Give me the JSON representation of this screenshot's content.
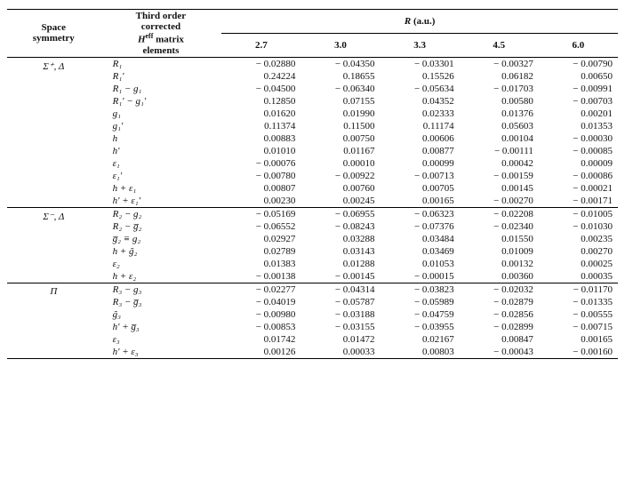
{
  "header": {
    "col_space": "Space\nsymmetry",
    "col_matrix": "Third order\ncorrected\nHᵉᵉ matrix\nelements",
    "col_r_header": "R (a.u.)",
    "r_values": [
      "2.7",
      "3.0",
      "3.3",
      "4.5",
      "6.0"
    ]
  },
  "sections": [
    {
      "sym": "Σ⁺, Δ",
      "rows": [
        {
          "label": "R₁",
          "vals": [
            "− 0.02880",
            "− 0.04350",
            "− 0.03301",
            "− 0.00327",
            "− 0.00790"
          ]
        },
        {
          "label": "R₁′",
          "vals": [
            "0.24224",
            "0.18655",
            "0.15526",
            "0.06182",
            "0.00650"
          ]
        },
        {
          "label": "R₁ − g₁",
          "vals": [
            "− 0.04500",
            "− 0.06340",
            "− 0.05634",
            "− 0.01703",
            "− 0.00991"
          ]
        },
        {
          "label": "R₁′ − g₁′",
          "vals": [
            "0.12850",
            "0.07155",
            "0.04352",
            "0.00580",
            "− 0.00703"
          ]
        },
        {
          "label": "g₁",
          "vals": [
            "0.01620",
            "0.01990",
            "0.02333",
            "0.01376",
            "0.00201"
          ]
        },
        {
          "label": "g₁′",
          "vals": [
            "0.11374",
            "0.11500",
            "0.11174",
            "0.05603",
            "0.01353"
          ]
        },
        {
          "label": "h",
          "vals": [
            "0.00883",
            "0.00750",
            "0.00606",
            "0.00104",
            "− 0.00030"
          ]
        },
        {
          "label": "h′",
          "vals": [
            "0.01010",
            "0.01167",
            "0.00877",
            "− 0.00111",
            "− 0.00085"
          ]
        },
        {
          "label": "ε₁",
          "vals": [
            "− 0.00076",
            "0.00010",
            "0.00099",
            "0.00042",
            "0.00009"
          ]
        },
        {
          "label": "ε₁′",
          "vals": [
            "− 0.00780",
            "− 0.00922",
            "− 0.00713",
            "− 0.00159",
            "− 0.00086"
          ]
        },
        {
          "label": "h + ε₁",
          "vals": [
            "0.00807",
            "0.00760",
            "0.00705",
            "0.00145",
            "− 0.00021"
          ]
        },
        {
          "label": "h′ + ε₁′",
          "vals": [
            "0.00230",
            "0.00245",
            "0.00165",
            "− 0.00270",
            "− 0.00171"
          ]
        }
      ]
    },
    {
      "sym": "Σ⁻, Δ",
      "rows": [
        {
          "label": "R₂ − g₂",
          "vals": [
            "− 0.05169",
            "− 0.06955",
            "− 0.06323",
            "− 0.02208",
            "− 0.01005"
          ]
        },
        {
          "label": "R₂ − g̅₂",
          "vals": [
            "− 0.06552",
            "− 0.08243",
            "− 0.07376",
            "− 0.02340",
            "− 0.01030"
          ]
        },
        {
          "label": "g̅₂ ≡ g₂",
          "vals": [
            "0.02927",
            "0.03288",
            "0.03484",
            "0.01550",
            "0.00235"
          ]
        },
        {
          "label": "h + g̃₂",
          "vals": [
            "0.02789",
            "0.03143",
            "0.03469",
            "0.01009",
            "0.00270"
          ]
        },
        {
          "label": "ε₂",
          "vals": [
            "0.01383",
            "0.01288",
            "0.01053",
            "0.00132",
            "0.00025"
          ]
        },
        {
          "label": "h + ε₂",
          "vals": [
            "− 0.00138",
            "− 0.00145",
            "− 0.00015",
            "0.00360",
            "0.00035"
          ]
        }
      ]
    },
    {
      "sym": "Π",
      "rows": [
        {
          "label": "R₃ − g₃",
          "vals": [
            "− 0.02277",
            "− 0.04314",
            "− 0.03823",
            "− 0.02032",
            "− 0.01170"
          ]
        },
        {
          "label": "R₃ − g̅₃",
          "vals": [
            "− 0.04019",
            "− 0.05787",
            "− 0.05989",
            "− 0.02879",
            "− 0.01335"
          ]
        },
        {
          "label": "g̃₃",
          "vals": [
            "− 0.00980",
            "− 0.03188",
            "− 0.04759",
            "− 0.02856",
            "− 0.00555"
          ]
        },
        {
          "label": "h′ + g̅₃",
          "vals": [
            "− 0.00853",
            "− 0.03155",
            "− 0.03955",
            "− 0.02899",
            "− 0.00715"
          ]
        },
        {
          "label": "ε₃",
          "vals": [
            "0.01742",
            "0.01472",
            "0.02167",
            "0.00847",
            "0.00165"
          ]
        },
        {
          "label": "h′ + ε₃",
          "vals": [
            "0.00126",
            "0.00033",
            "0.00803",
            "− 0.00043",
            "− 0.00160"
          ]
        }
      ]
    }
  ]
}
